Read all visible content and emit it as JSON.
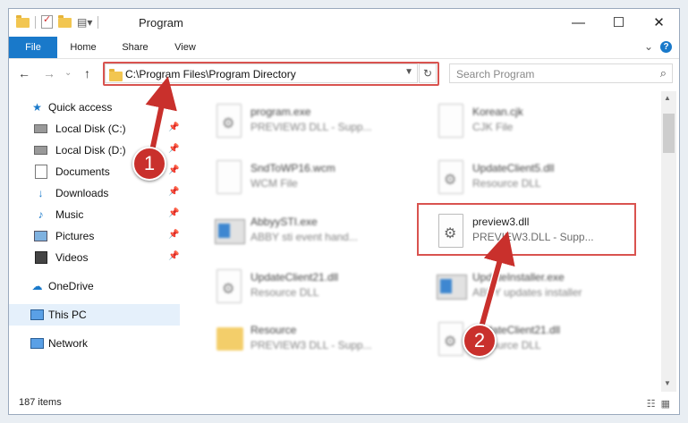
{
  "window": {
    "title": "Program",
    "minimize": "—",
    "maximize": "☐",
    "close": "✕"
  },
  "ribbon": {
    "tabs": [
      "File",
      "Home",
      "Share",
      "View"
    ],
    "expand": "⌄",
    "help": "?"
  },
  "nav": {
    "back": "←",
    "forward": "→",
    "recent": "⌄",
    "up": "↑",
    "address": "C:\\Program Files\\Program Directory",
    "search_placeholder": "Search Program"
  },
  "sidebar": {
    "quick_access": "Quick access",
    "items": [
      {
        "label": "Local Disk (C:)",
        "icon": "drive-icon",
        "pinned": true
      },
      {
        "label": "Local Disk (D:)",
        "icon": "drive-icon",
        "pinned": true
      },
      {
        "label": "Documents",
        "icon": "documents-icon",
        "pinned": true
      },
      {
        "label": "Downloads",
        "icon": "downloads-icon",
        "pinned": true
      },
      {
        "label": "Music",
        "icon": "music-icon",
        "pinned": true
      },
      {
        "label": "Pictures",
        "icon": "pictures-icon",
        "pinned": true
      },
      {
        "label": "Videos",
        "icon": "videos-icon",
        "pinned": true
      }
    ],
    "onedrive": "OneDrive",
    "this_pc": "This PC",
    "network": "Network"
  },
  "files": [
    {
      "name": "program.exe",
      "type": "PREVIEW3 DLL - Supp..."
    },
    {
      "name": "Korean.cjk",
      "type": "CJK File"
    },
    {
      "name": "SndToWP16.wcm",
      "type": "WCM File"
    },
    {
      "name": "UpdateClient5.dll",
      "type": "Resource DLL"
    },
    {
      "name": "AbbyySTI.exe",
      "type": "ABBY sti event hand..."
    },
    {
      "name": "preview3.dll",
      "type": "PREVIEW3.DLL - Supp..."
    },
    {
      "name": "UpdateClient21.dll",
      "type": "Resource DLL"
    },
    {
      "name": "UpdateInstaller.exe",
      "type": "ABBY updates installer"
    },
    {
      "name": "Resource",
      "type": "PREVIEW3 DLL - Supp..."
    },
    {
      "name": "UpdateClient21.dll",
      "type": "Resource DLL"
    }
  ],
  "status": {
    "items": "187 items"
  },
  "callouts": {
    "step1": "1",
    "step2": "2"
  },
  "colors": {
    "accent": "#1979ca",
    "highlight": "#d9534f",
    "badge": "#c9302c"
  }
}
